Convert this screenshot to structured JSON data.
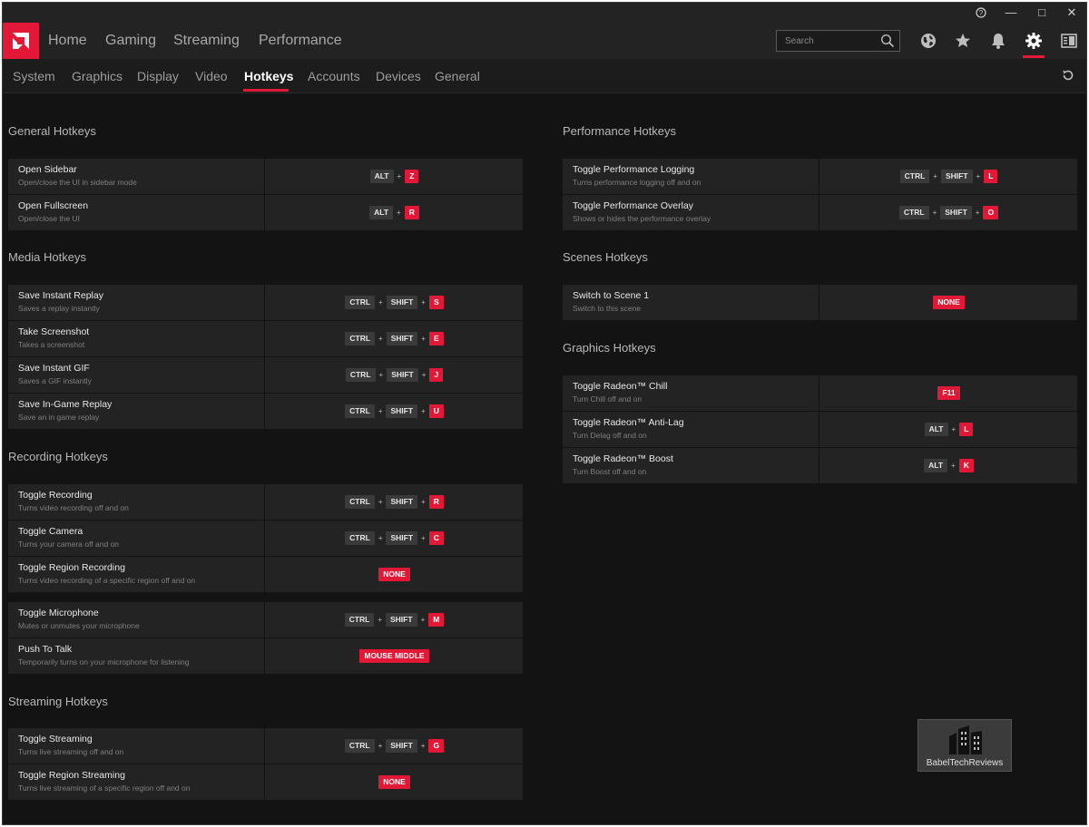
{
  "titlebar": {
    "help": "?",
    "minimize": "—",
    "maximize": "□",
    "close": "✕"
  },
  "nav": {
    "home": "Home",
    "gaming": "Gaming",
    "streaming": "Streaming",
    "performance": "Performance"
  },
  "search": {
    "placeholder": "Search"
  },
  "icons": {
    "accent": "#e31837",
    "world": "globe-icon",
    "favorite": "star-icon",
    "notifications": "bell-icon",
    "settings": "gear-icon",
    "layout": "sidebar-layout-icon",
    "refresh": "reset-icon"
  },
  "subnav": {
    "system": "System",
    "graphics": "Graphics",
    "display": "Display",
    "video": "Video",
    "hotkeys": "Hotkeys",
    "accounts": "Accounts",
    "devices": "Devices",
    "general": "General"
  },
  "sections": {
    "general": {
      "title": "General Hotkeys",
      "rows": [
        {
          "name": "Open Sidebar",
          "desc": "Open/close the UI in sidebar mode",
          "keys": [
            "ALT",
            "Z"
          ]
        },
        {
          "name": "Open Fullscreen",
          "desc": "Open/close the UI",
          "keys": [
            "ALT",
            "R"
          ]
        }
      ]
    },
    "media": {
      "title": "Media Hotkeys",
      "rows": [
        {
          "name": "Save Instant Replay",
          "desc": "Saves a replay instantly",
          "keys": [
            "CTRL",
            "SHIFT",
            "S"
          ]
        },
        {
          "name": "Take Screenshot",
          "desc": "Takes a screenshot",
          "keys": [
            "CTRL",
            "SHIFT",
            "E"
          ]
        },
        {
          "name": "Save Instant GIF",
          "desc": "Saves a GIF instantly",
          "keys": [
            "CTRL",
            "SHIFT",
            "J"
          ]
        },
        {
          "name": "Save In-Game Replay",
          "desc": "Save an in game replay",
          "keys": [
            "CTRL",
            "SHIFT",
            "U"
          ]
        }
      ]
    },
    "recording": {
      "title": "Recording Hotkeys",
      "rows": [
        {
          "name": "Toggle Recording",
          "desc": "Turns video recording off and on",
          "keys": [
            "CTRL",
            "SHIFT",
            "R"
          ]
        },
        {
          "name": "Toggle Camera",
          "desc": "Turns your camera off and on",
          "keys": [
            "CTRL",
            "SHIFT",
            "C"
          ]
        },
        {
          "name": "Toggle Region Recording",
          "desc": "Turns video recording of a specific region off and on",
          "keys": [
            "NONE"
          ]
        }
      ]
    },
    "microphone": {
      "rows": [
        {
          "name": "Toggle Microphone",
          "desc": "Mutes or unmutes your microphone",
          "keys": [
            "CTRL",
            "SHIFT",
            "M"
          ]
        },
        {
          "name": "Push To Talk",
          "desc": "Temporarily turns on your microphone for listening",
          "keys": [
            "MOUSE MIDDLE"
          ]
        }
      ]
    },
    "streaming": {
      "title": "Streaming Hotkeys",
      "rows": [
        {
          "name": "Toggle Streaming",
          "desc": "Turns live streaming off and on",
          "keys": [
            "CTRL",
            "SHIFT",
            "G"
          ]
        },
        {
          "name": "Toggle Region Streaming",
          "desc": "Turns live streaming of a specific region off and on",
          "keys": [
            "NONE"
          ]
        }
      ]
    },
    "performance": {
      "title": "Performance Hotkeys",
      "rows": [
        {
          "name": "Toggle Performance Logging",
          "desc": "Turns performance logging off and on",
          "keys": [
            "CTRL",
            "SHIFT",
            "L"
          ]
        },
        {
          "name": "Toggle Performance Overlay",
          "desc": "Shows or hides the performance overlay",
          "keys": [
            "CTRL",
            "SHIFT",
            "O"
          ]
        }
      ]
    },
    "scenes": {
      "title": "Scenes Hotkeys",
      "rows": [
        {
          "name": "Switch to Scene 1",
          "desc": "Switch to this scene",
          "keys": [
            "NONE"
          ]
        }
      ]
    },
    "graphics": {
      "title": "Graphics Hotkeys",
      "rows": [
        {
          "name": "Toggle Radeon™ Chill",
          "desc": "Turn Chill off and on",
          "keys": [
            "F11"
          ]
        },
        {
          "name": "Toggle Radeon™ Anti-Lag",
          "desc": "Turn Delag off and on",
          "keys": [
            "ALT",
            "L"
          ]
        },
        {
          "name": "Toggle Radeon™ Boost",
          "desc": "Turn Boost off and on",
          "keys": [
            "ALT",
            "K"
          ]
        }
      ]
    }
  },
  "watermark": {
    "text": "BabelTechReviews"
  }
}
